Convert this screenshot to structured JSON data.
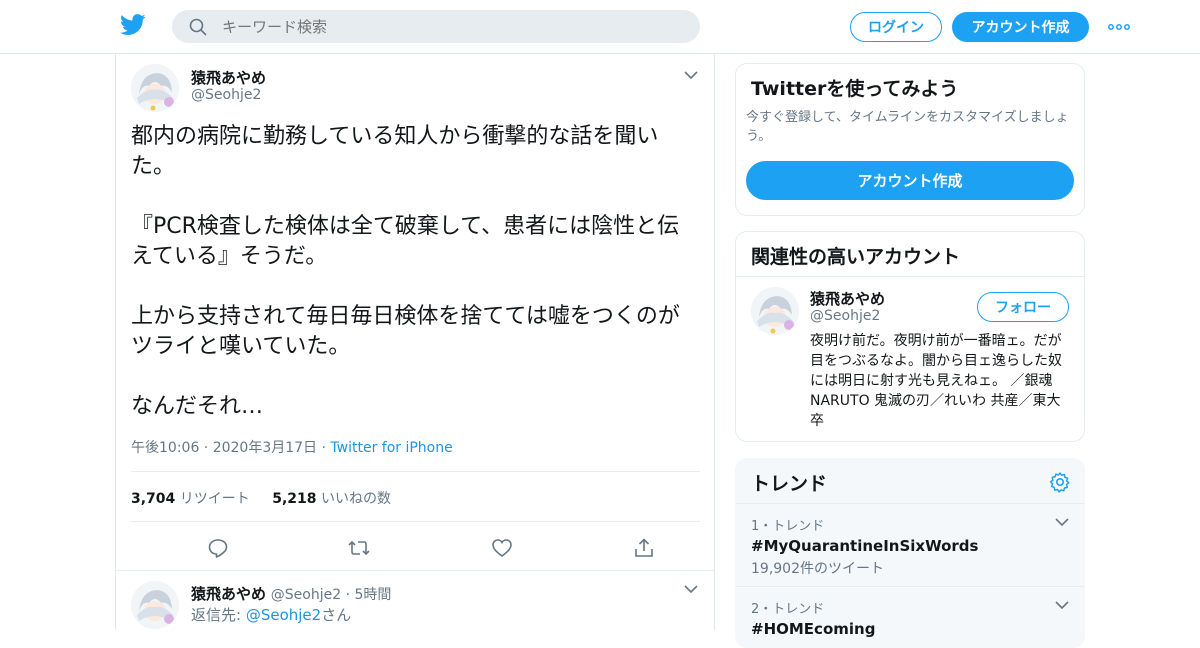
{
  "header": {
    "search_placeholder": "キーワード検索",
    "login_label": "ログイン",
    "signup_label": "アカウント作成"
  },
  "tweet": {
    "name": "猿飛あやめ",
    "handle": "@Seohje2",
    "paragraphs": [
      "都内の病院に勤務している知人から衝撃的な話を聞いた。",
      "『PCR検査した検体は全て破棄して、患者には陰性と伝えている』そうだ。",
      "上から支持されて毎日毎日検体を捨てては嘘をつくのがツライと嘆いていた。",
      "なんだそれ…"
    ],
    "time": "午後10:06 · 2020年3月17日 · ",
    "source": "Twitter for iPhone",
    "retweets_count": "3,704",
    "retweets_label": "リツイート",
    "likes_count": "5,218",
    "likes_label": "いいねの数"
  },
  "reply": {
    "name": "猿飛あやめ",
    "meta": "@Seohje2 · 5時間",
    "replying_prefix": "返信先: ",
    "replying_handle": "@Seohje2",
    "replying_suffix": "さん"
  },
  "sidebar": {
    "signup_card": {
      "title": "Twitterを使ってみよう",
      "desc": "今すぐ登録して、タイムラインをカスタマイズしましょう。",
      "button": "アカウント作成"
    },
    "related": {
      "title": "関連性の高いアカウント",
      "name": "猿飛あやめ",
      "handle": "@Seohje2",
      "follow": "フォロー",
      "bio": "夜明け前だ。夜明け前が一番暗ェ。だが目をつぶるなよ。闇から目ェ逸らした奴には明日に射す光も見えねェ。 ／銀魂 NARUTO 鬼滅の刃／れいわ 共産／東大卒"
    },
    "trends": {
      "title": "トレンド",
      "items": [
        {
          "meta": "1・トレンド",
          "name": "#MyQuarantineInSixWords",
          "count": "19,902件のツイート"
        },
        {
          "meta": "2・トレンド",
          "name": "#HOMEcoming"
        }
      ]
    }
  },
  "colors": {
    "accent": "#1da1f2",
    "link": "#1b95e0",
    "text": "#14171a",
    "muted": "#657786"
  }
}
